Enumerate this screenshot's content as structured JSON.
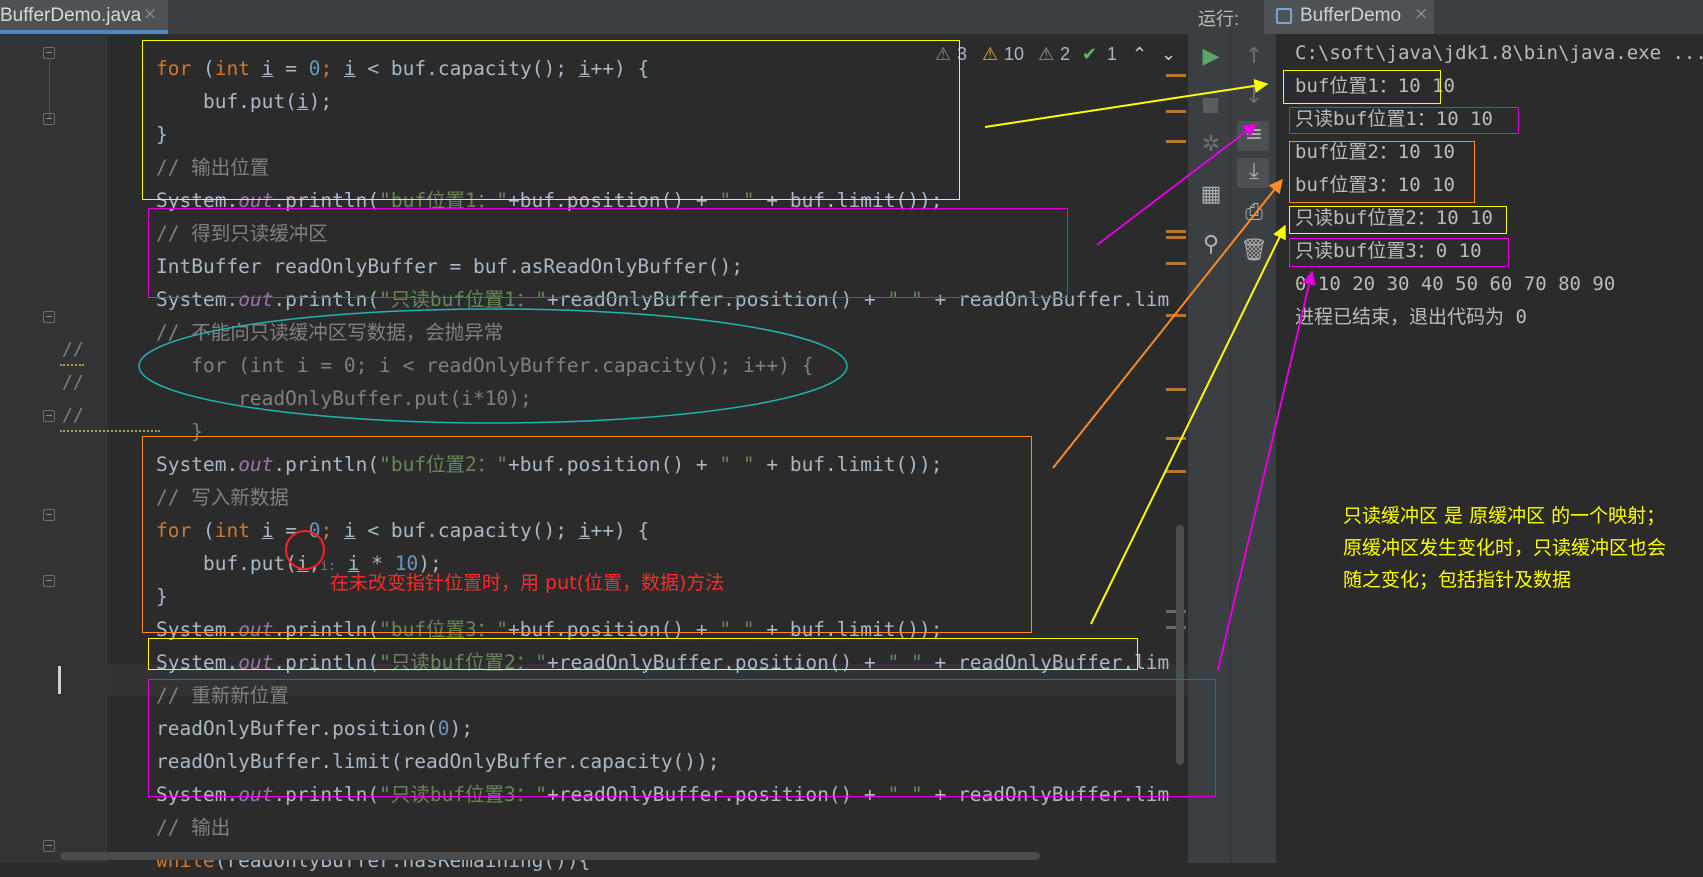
{
  "editor": {
    "tab": {
      "filename": "BufferDemo.java",
      "close": "×"
    },
    "inspections": {
      "weak_warnings": "3",
      "warnings": "10",
      "typos": "2",
      "ok": "1"
    },
    "lines": {
      "l1_a": "for",
      "l1_b": " (",
      "l1_c": "int",
      "l1_d": " ",
      "l1_e": "i",
      "l1_f": " = ",
      "l1_g": "0",
      "l1_h": "; ",
      "l1_i": "i",
      "l1_j": " < buf.capacity(); ",
      "l1_k": "i",
      "l1_l": "++) {",
      "l2_a": "    buf.put(",
      "l2_b": "i",
      "l2_c": ");",
      "l3": "}",
      "l4": "// 输出位置",
      "l5_a": "System.",
      "l5_b": "out",
      "l5_c": ".println(",
      "l5_d": "\"buf位置1：\"",
      "l5_e": "+buf.position() + ",
      "l5_f": "\" \"",
      "l5_g": " + buf.limit());",
      "l6": "// 得到只读缓冲区",
      "l7_a": "IntBuffer readOnlyBuffer = buf.asReadOnlyBuffer();",
      "l8_a": "System.",
      "l8_b": "out",
      "l8_c": ".println(",
      "l8_d": "\"只读buf位置1：\"",
      "l8_e": "+readOnlyBuffer.position() + ",
      "l8_f": "\" \"",
      "l8_g": " + readOnlyBuffer.lim",
      "l9": "// 不能向只读缓冲区写数据，会抛异常",
      "l10": "   for (int i = 0; i < readOnlyBuffer.capacity(); i++) {",
      "l11": "       readOnlyBuffer.put(i*10);",
      "l12": "   }",
      "l13_a": "System.",
      "l13_b": "out",
      "l13_c": ".println(",
      "l13_d": "\"buf位置2：\"",
      "l13_e": "+buf.position() + ",
      "l13_f": "\" \"",
      "l13_g": " + buf.limit());",
      "l14": "// 写入新数据",
      "l15_a": "for",
      "l15_b": " (",
      "l15_c": "int",
      "l15_d": " ",
      "l15_e": "i",
      "l15_f": " = ",
      "l15_g": "0",
      "l15_h": "; ",
      "l15_i": "i",
      "l15_j": " < buf.capacity(); ",
      "l15_k": "i",
      "l15_l": "++) {",
      "l16_a": "    buf.put(",
      "l16_b": "i",
      "l16_c": ",",
      "l16_hint": "i:",
      "l16_d": " ",
      "l16_e": "i",
      "l16_f": " * ",
      "l16_g": "10",
      "l16_h": ");",
      "l17": "}",
      "l18_a": "System.",
      "l18_b": "out",
      "l18_c": ".println(",
      "l18_d": "\"buf位置3：\"",
      "l18_e": "+buf.position() + ",
      "l18_f": "\" \"",
      "l18_g": " + buf.limit());",
      "l19_a": "System.",
      "l19_b": "out",
      "l19_c": ".println(",
      "l19_d": "\"只读buf位置2：\"",
      "l19_e": "+readOnlyBuffer.position() + ",
      "l19_f": "\" \"",
      "l19_g": " + readOnlyBuffer.lim",
      "l20": "// 重新新位置",
      "l21_a": "readOnlyBuffer.position(",
      "l21_b": "0",
      "l21_c": ");",
      "l22": "readOnlyBuffer.limit(readOnlyBuffer.capacity());",
      "l23_a": "System.",
      "l23_b": "out",
      "l23_c": ".println(",
      "l23_d": "\"只读buf位置3：\"",
      "l23_e": "+readOnlyBuffer.position() + ",
      "l23_f": "\" \"",
      "l23_g": " + readOnlyBuffer.lim",
      "l24": "// 输出",
      "l25_a": "while",
      "l25_b": "(readOnlyBuffer.hasRemaining()){"
    },
    "comment_marks": [
      "//",
      "//",
      "//"
    ]
  },
  "run": {
    "label": "运行:",
    "tab": {
      "name": "BufferDemo",
      "close": "×"
    },
    "console": [
      "C:\\soft\\java\\jdk1.8\\bin\\java.exe ...",
      "buf位置1：10 10",
      "只读buf位置1：10 10",
      "buf位置2：10 10",
      "buf位置3：10 10",
      "只读buf位置2：10 10",
      "只读buf位置3：0 10",
      "0 10 20 30 40 50 60 70 80 90",
      "进程已结束，退出代码为 0"
    ]
  },
  "annotations": {
    "red_note": "在未改变指针位置时，用 put(位置，数据)方法",
    "yellow_note": [
      "只读缓冲区 是 原缓冲区 的一个映射；",
      "原缓冲区发生变化时，只读缓冲区也会",
      "随之变化；包括指针及数据"
    ],
    "colors": {
      "yellow": "#ffff00",
      "magenta": "#e000e0",
      "orange": "#ff8a2a",
      "cyan": "#1fb5b5",
      "red": "#ff2020"
    }
  }
}
